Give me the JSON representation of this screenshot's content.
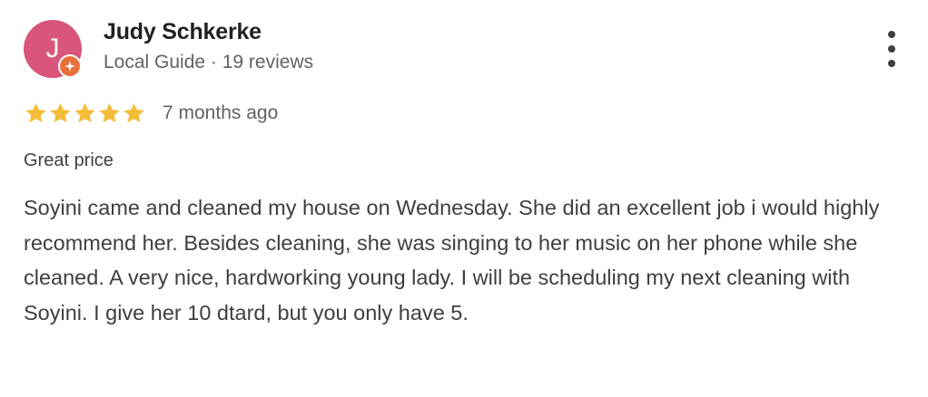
{
  "review": {
    "author": {
      "initial": "J",
      "name": "Judy Schkerke",
      "meta": "Local Guide · 19 reviews",
      "avatar_color": "#d9557c",
      "badge_color": "#e8703a",
      "badge_icon": "local-guide-star-icon"
    },
    "more_icon": "more-vert-icon",
    "rating": 5,
    "rating_max": 5,
    "star_color": "#f4bd37",
    "date": "7 months ago",
    "title": "Great price",
    "body": "Soyini came and cleaned my house on Wednesday. She did an excellent job i would highly recommend her. Besides cleaning, she was singing to her music on her phone while she cleaned. A very nice, hardworking young lady. I will be scheduling my next cleaning with Soyini. I give her 10 dtard, but you only have 5."
  }
}
